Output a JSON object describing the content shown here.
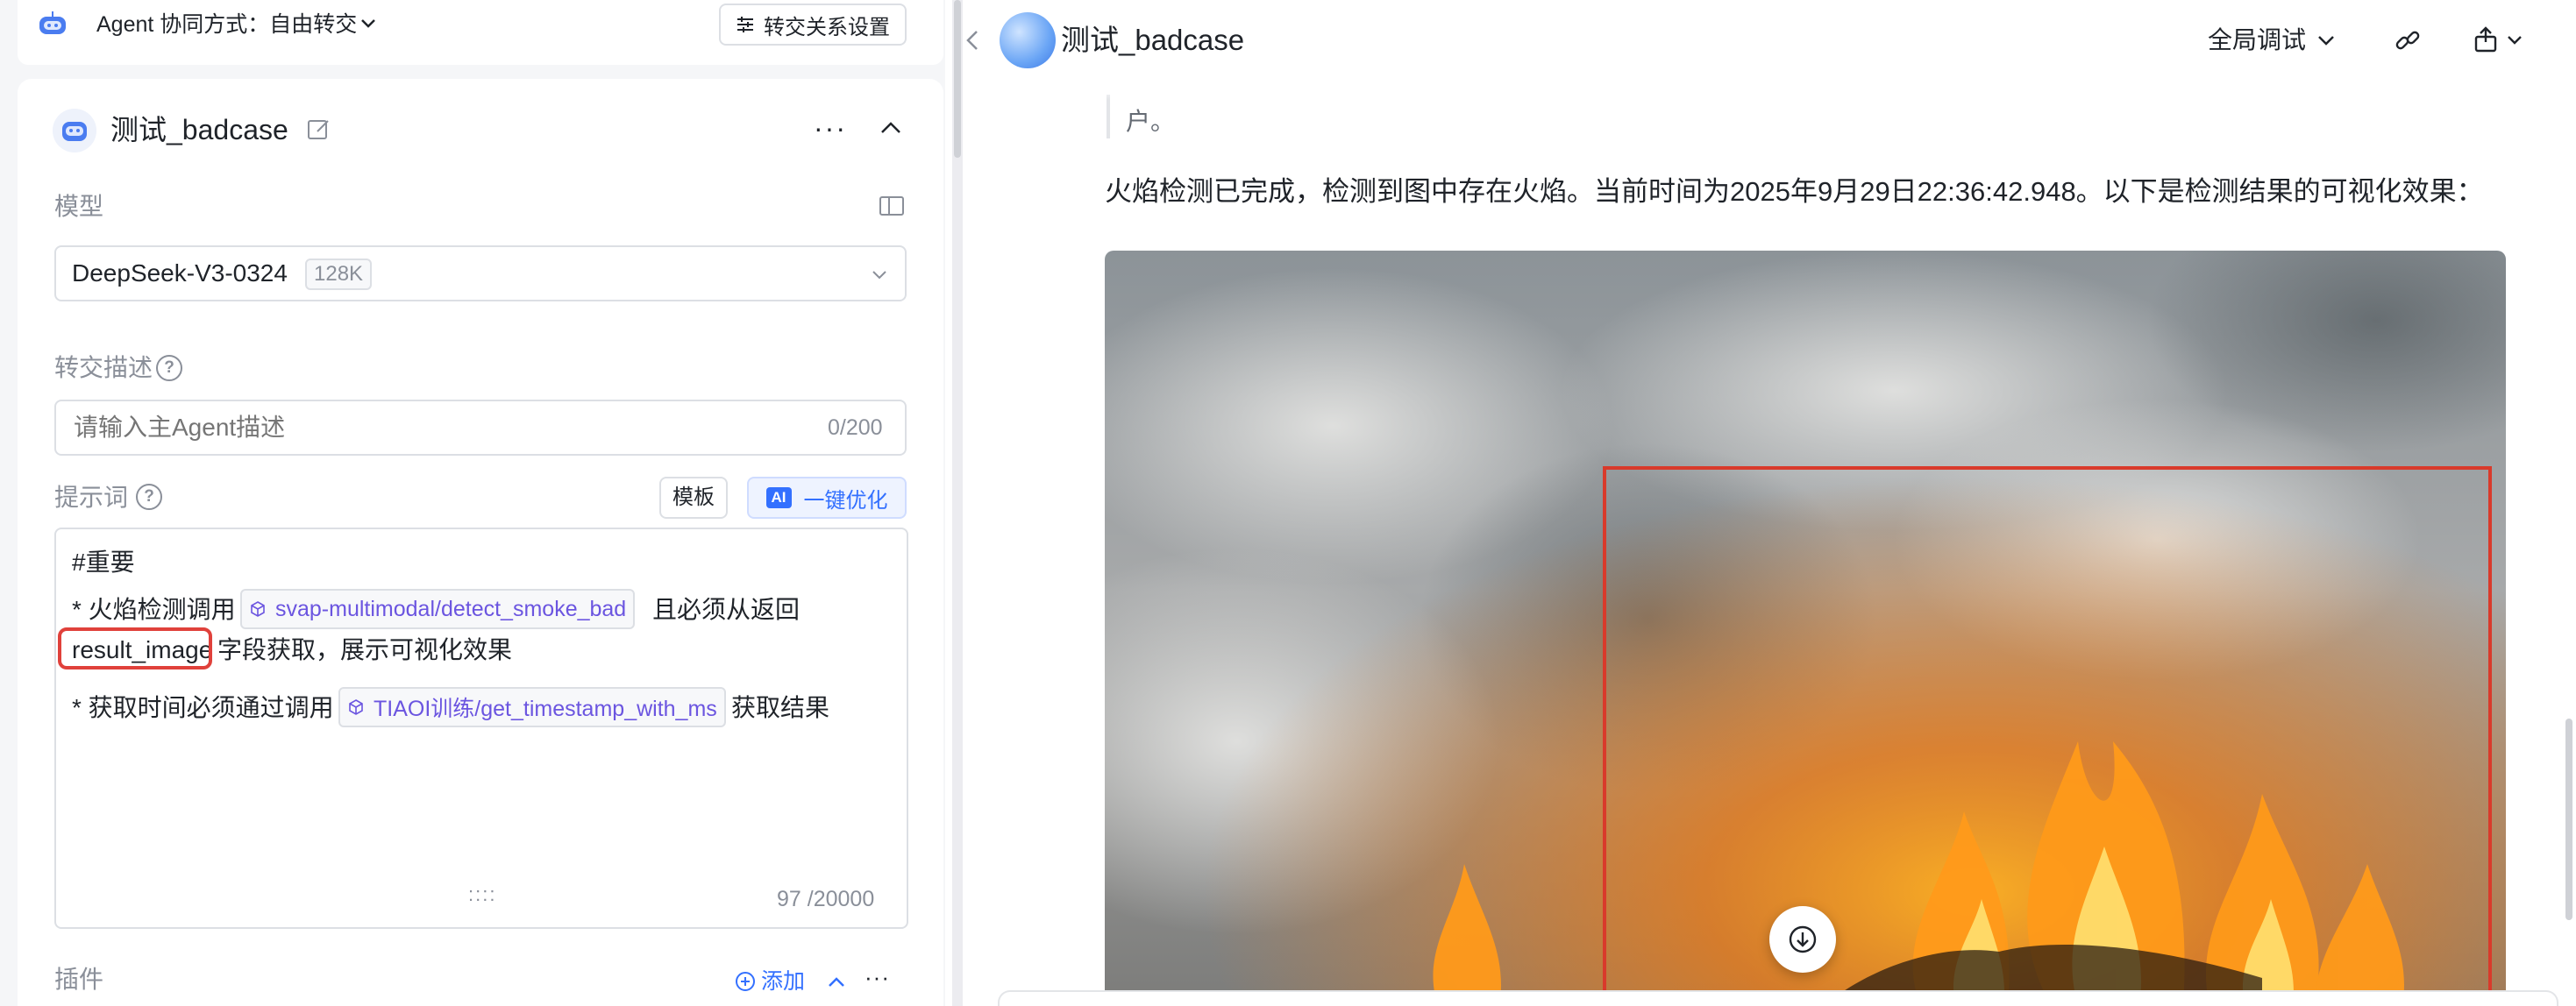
{
  "left": {
    "mode_label": "Agent 协同方式：自由转交",
    "transfer_settings": "转交关系设置",
    "agent_name": "测试_badcase",
    "more": "···",
    "model_section": "模型",
    "model_name": "DeepSeek-V3-0324",
    "model_tag": "128K",
    "desc_section": "转交描述",
    "desc_placeholder": "请输入主Agent描述",
    "desc_count": "0/200",
    "prompt_section": "提示词",
    "template_btn": "模板",
    "ai_badge": "AI",
    "optimize_btn": "一键优化",
    "prompt": {
      "line1": "#重要",
      "line2_prefix": "* 火焰检测调用",
      "tool1": "svap-multimodal/detect_smoke_bad",
      "line2_suffix": "且必须从返回",
      "line3_highlight": "result_image",
      "line3_suffix": "字段获取，展示可视化效果",
      "line4_prefix": "* 获取时间必须通过调用",
      "tool2": "TIAOI训练/get_timestamp_with_ms",
      "line4_suffix": "获取结果",
      "drag": "::::",
      "count": "97 /20000"
    },
    "plugin_section": "插件",
    "add_btn": "添加",
    "plugin_more": "···"
  },
  "right": {
    "title": "测试_badcase",
    "debug_select": "全局调试",
    "quote_text": "户。",
    "message": "火焰检测已完成，检测到图中存在火焰。当前时间为2025年9月29日22:36:42.948。以下是检测结果的可视化效果："
  },
  "colors": {
    "accent": "#3370ff",
    "tool_chip_text": "#6b55e0",
    "highlight_red": "#e0413b",
    "detect_box": "#d93a2b"
  },
  "icons": [
    "robot-icon",
    "chevron-down-icon",
    "sliders-icon",
    "edit-icon",
    "chevron-up-icon",
    "book-icon",
    "help-icon",
    "cube-icon",
    "plus-circle-icon",
    "back-chevron-icon",
    "link-icon",
    "share-icon",
    "arrow-down-icon"
  ]
}
